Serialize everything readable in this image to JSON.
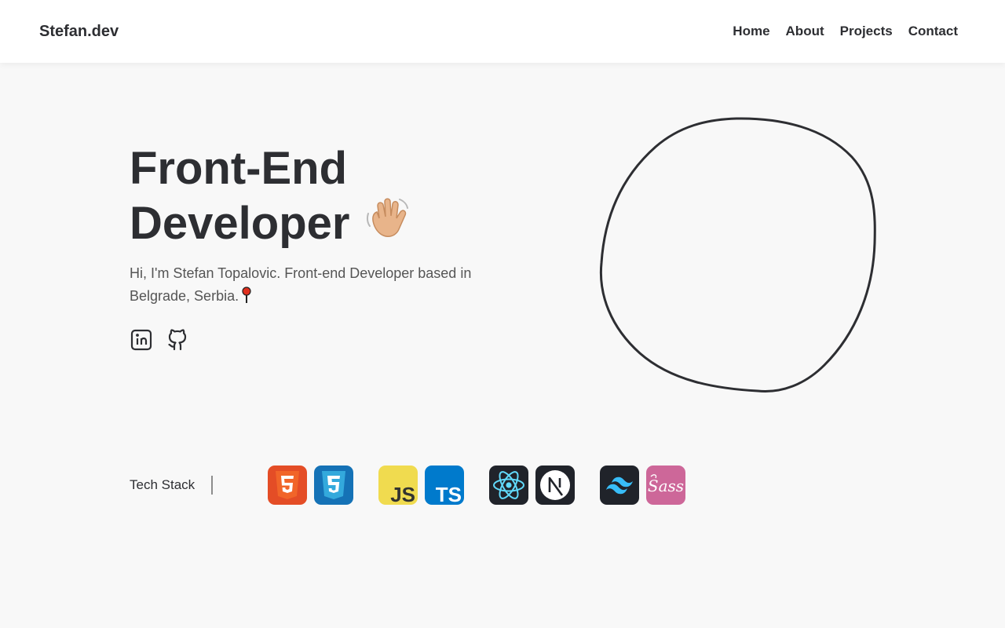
{
  "nav": {
    "logo": "Stefan.dev",
    "links": [
      "Home",
      "About",
      "Projects",
      "Contact"
    ]
  },
  "hero": {
    "title_line1": "Front-End",
    "title_line2": "Developer",
    "wave_icon": "waving-hand-icon",
    "intro": "Hi, I'm Stefan Topalovic. Front-end Developer based in Belgrade, Serbia.",
    "pin_icon": "pushpin-icon",
    "socials": [
      "linkedin-icon",
      "github-icon"
    ]
  },
  "tech_stack": {
    "label": "Tech Stack",
    "icons": [
      "html5-icon",
      "css3-icon",
      "javascript-icon",
      "typescript-icon",
      "react-icon",
      "nextjs-icon",
      "tailwind-icon",
      "sass-icon"
    ]
  },
  "colors": {
    "background": "#f8f8f8",
    "text": "#2d2e32",
    "html5": "#e44d26",
    "css3": "#1572b6",
    "javascript": "#f0db4f",
    "typescript": "#007acc",
    "react_bg": "#20232a",
    "react": "#61dafb",
    "tailwind": "#38bdf8",
    "sass": "#cd6799"
  }
}
